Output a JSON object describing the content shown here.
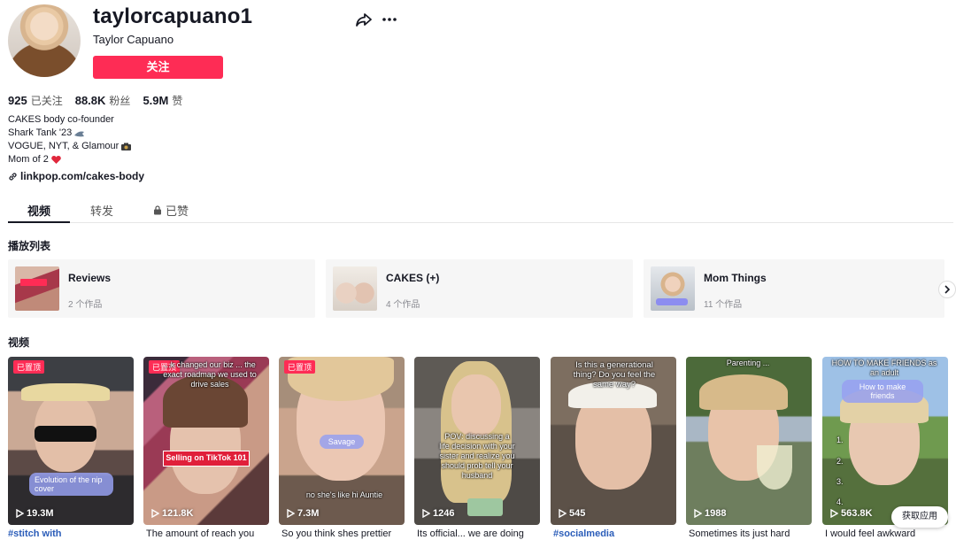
{
  "profile": {
    "username": "taylorcapuano1",
    "nickname": "Taylor Capuano",
    "follow_label": "关注",
    "stats": [
      {
        "num": "925",
        "label": "已关注"
      },
      {
        "num": "88.8K",
        "label": "粉丝"
      },
      {
        "num": "5.9M",
        "label": "赞"
      }
    ],
    "bio": [
      "CAKES body co-founder",
      "Shark Tank '23",
      "VOGUE, NYT, & Glamour",
      "Mom of 2"
    ],
    "link": "linkpop.com/cakes-body"
  },
  "tabs": [
    "视频",
    "转发",
    "已赞"
  ],
  "playlists_title": "播放列表",
  "playlists": [
    {
      "name": "Reviews",
      "count": "2 个作品"
    },
    {
      "name": "CAKES (+)",
      "count": "4 个作品"
    },
    {
      "name": "Mom Things",
      "count": "11 个作品"
    }
  ],
  "videos_title": "视频",
  "videos": [
    {
      "views": "19.3M",
      "pinned": "已置顶",
      "caption": "#stitch with",
      "overlay": "Evolution of the nip cover"
    },
    {
      "views": "121.8K",
      "pinned": "已置顶",
      "caption": "The amount of reach you",
      "overlay_top": "...k changed our biz ... the exact roadmap we used to drive sales",
      "overlay": "Selling on TikTok 101"
    },
    {
      "views": "7.3M",
      "pinned": "已置顶",
      "caption": "So you think shes prettier",
      "overlay": "Savage",
      "overlay2": "no she's like hi Auntie"
    },
    {
      "views": "1246",
      "caption": "Its official... we are doing",
      "overlay": "POV: discussing a life decision with your sister and realize you should prob tell your husband"
    },
    {
      "views": "545",
      "caption": "#socialmedia",
      "overlay": "Is this a generational thing? Do you feel the same way?"
    },
    {
      "views": "1988",
      "caption": "Sometimes its just hard",
      "overlay": "Parenting ..."
    },
    {
      "views": "563.8K",
      "caption": "I would feel awkward",
      "overlay": "HOW TO MAKE FRIENDS as an adult",
      "overlay2": "How to make friends",
      "list": [
        "1.",
        "2.",
        "3.",
        "4."
      ]
    }
  ],
  "app_button": "获取应用",
  "colors": {
    "accent": "#fe2c55",
    "tag": "#2b5db9"
  }
}
